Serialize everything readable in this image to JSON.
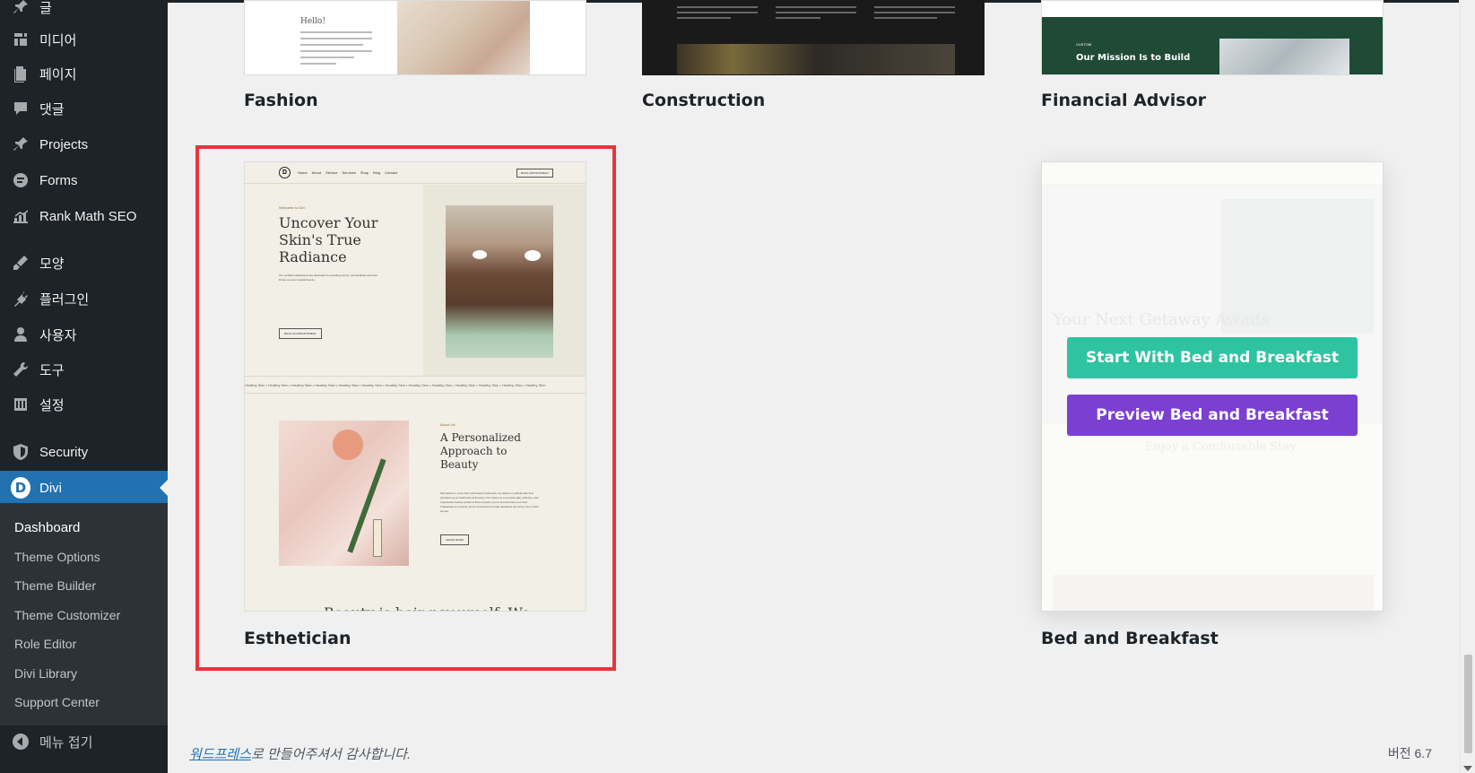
{
  "sidebar": {
    "items": [
      {
        "label": "글",
        "icon": "pin-icon"
      },
      {
        "label": "미디어",
        "icon": "media-icon"
      },
      {
        "label": "페이지",
        "icon": "page-icon"
      },
      {
        "label": "댓글",
        "icon": "comment-icon"
      },
      {
        "label": "Projects",
        "icon": "pin-icon"
      },
      {
        "label": "Forms",
        "icon": "forms-icon"
      },
      {
        "label": "Rank Math SEO",
        "icon": "chart-icon"
      },
      {
        "label": "모양",
        "icon": "brush-icon"
      },
      {
        "label": "플러그인",
        "icon": "plug-icon"
      },
      {
        "label": "사용자",
        "icon": "user-icon"
      },
      {
        "label": "도구",
        "icon": "wrench-icon"
      },
      {
        "label": "설정",
        "icon": "settings-icon"
      },
      {
        "label": "Security",
        "icon": "shield-icon"
      },
      {
        "label": "Divi",
        "icon": "divi-icon"
      }
    ],
    "submenu": [
      "Dashboard",
      "Theme Options",
      "Theme Builder",
      "Theme Customizer",
      "Role Editor",
      "Divi Library",
      "Support Center"
    ],
    "collapse_label": "메뉴 접기"
  },
  "cards": {
    "fashion": {
      "title": "Fashion",
      "hello": "Hello!"
    },
    "construction": {
      "title": "Construction"
    },
    "financial": {
      "title": "Financial Advisor",
      "custom": "CUSTOM",
      "mission": "Our Mission Is to Build"
    },
    "esthetician": {
      "title": "Esthetician",
      "nav": [
        "Home",
        "About",
        "Service",
        "Services",
        "Shop",
        "Blog",
        "Contact"
      ],
      "nav_button": "BOOK APPOINTMENT",
      "welcome": "Welcome to Divi",
      "headline": "Uncover Your Skin's True Radiance",
      "body": "Our certified estheticians are dedicated to providing top-tier, personalized care that brings out your natural beauty.",
      "cta": "BOOK AN APPOINTMENT",
      "ticker": "Healthy Skin • Healthy Skin • Healthy Skin • Healthy Skin • Healthy Skin • Healthy Skin • Healthy Skin • Healthy Skin • Healthy Skin • Healthy Skin • Healthy Skin • Healthy Skin • Healthy Skin",
      "about": "About Us",
      "section_title": "A Personalized Approach to Beauty",
      "section_body": "We believe in more than just beauty treatments; we believe in ethical care that prioritizes your health and well-being. Our mission is to provide safe, effective, and responsible beauty solutions that empower you to feel and look your best. Transparency, honesty, and a commitment to high standards are at the core of who we are.",
      "learn": "LEARN MORE",
      "footer_text": "Beauty is being yourself. We"
    },
    "bnb": {
      "title": "Bed and Breakfast",
      "faded_title": "Your Next Getaway Awaits",
      "faded_sub": "Enjoy a Comfortable Stay",
      "start_label": "Start With Bed and Breakfast",
      "preview_label": "Preview Bed and Breakfast"
    }
  },
  "colors": {
    "start_button": "#2ec4a2",
    "preview_button": "#7b3fd1",
    "highlight": "#e8353c",
    "active_menu": "#2271b1"
  },
  "footer": {
    "link": "워드프레스",
    "text": "로 만들어주셔서 감사합니다.",
    "version": "버전 6.7"
  }
}
